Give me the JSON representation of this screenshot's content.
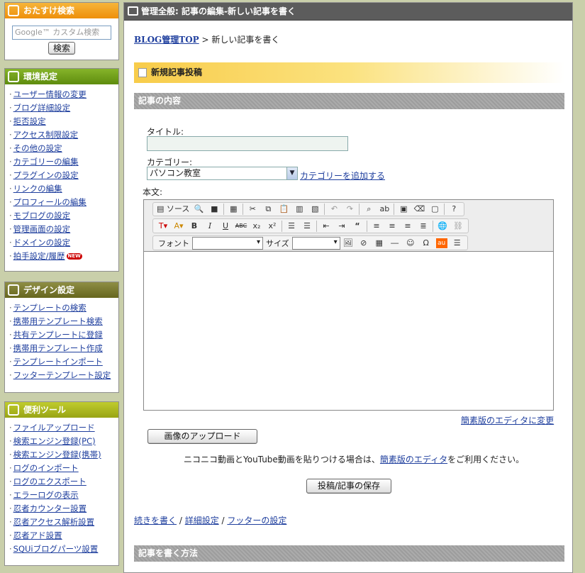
{
  "search": {
    "title": "おたすけ検索",
    "placeholder": "Google™ カスタム検索",
    "button": "検索"
  },
  "env": {
    "title": "環境設定",
    "items": [
      "ユーザー情報の変更",
      "ブログ詳細設定",
      "拒否設定",
      "アクセス制限設定",
      "その他の設定",
      "カテゴリーの編集",
      "プラグインの設定",
      "リンクの編集",
      "プロフィールの編集",
      "モブログの設定",
      "管理画面の設定",
      "ドメインの設定",
      "拍手設定/履歴"
    ],
    "new_badge": "NEW"
  },
  "design": {
    "title": "デザイン設定",
    "items": [
      "テンプレートの検索",
      "携帯用テンプレート検索",
      "共有テンプレートに登録",
      "携帯用テンプレート作成",
      "テンプレートインポート",
      "フッターテンプレート設定"
    ]
  },
  "tools": {
    "title": "便利ツール",
    "items": [
      "ファイルアップロード",
      "検索エンジン登録(PC)",
      "検索エンジン登録(携帯)",
      "ログのインポート",
      "ログのエクスポート",
      "エラーログの表示",
      "忍者カウンター設置",
      "忍者アクセス解析設置",
      "忍者アド設置",
      "SQUiブログパーツ設置"
    ]
  },
  "main": {
    "title": "管理全般: 記事の編集-新しい記事を書く",
    "breadcrumb_link": "BLOG管理TOP",
    "breadcrumb_sep": " > ",
    "breadcrumb_current": "新しい記事を書く",
    "post_header": "新規記事投稿",
    "content_header": "記事の内容",
    "title_label": "タイトル:",
    "title_value": "",
    "category_label": "カテゴリー:",
    "category_value": "パソコン教室",
    "add_category": "カテゴリーを追加する",
    "body_label": "本文:",
    "toolbar": {
      "source": "ソース",
      "font": "フォント",
      "size": "サイズ"
    },
    "simple_editor_link": "簡素版のエディタに変更",
    "upload_button": "画像のアップロード",
    "note_pre": "ニコニコ動画とYouTube動画を貼りつける場合は、",
    "note_link": "簡素版のエディタ",
    "note_post": "をご利用ください。",
    "save_button": "投稿/記事の保存",
    "footer_links": [
      "続きを書く",
      "詳細設定",
      "フッターの設定"
    ],
    "howto_header": "記事を書く方法"
  },
  "colors": {
    "search_header": "#f29b12",
    "env_header": "#6b9a14",
    "design_header": "#76762e",
    "tools_header": "#a9b51c"
  }
}
